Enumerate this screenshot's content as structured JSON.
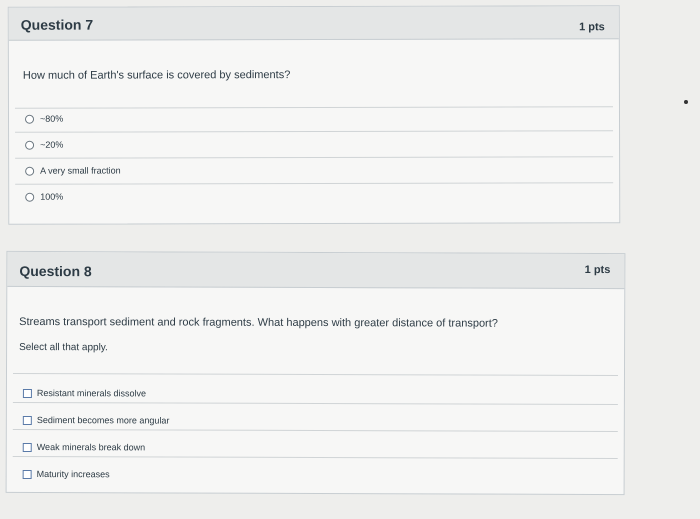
{
  "q7": {
    "title": "Question 7",
    "points": "1 pts",
    "text": "How much of Earth's surface is covered by sediments?",
    "options": [
      "~80%",
      "~20%",
      "A very small fraction",
      "100%"
    ]
  },
  "q8": {
    "title": "Question 8",
    "points": "1 pts",
    "text": "Streams transport sediment and rock fragments. What happens with greater distance of transport?",
    "instruction": "Select all that apply.",
    "options": [
      "Resistant minerals dissolve",
      "Sediment becomes more angular",
      "Weak minerals break down",
      "Maturity increases"
    ]
  }
}
